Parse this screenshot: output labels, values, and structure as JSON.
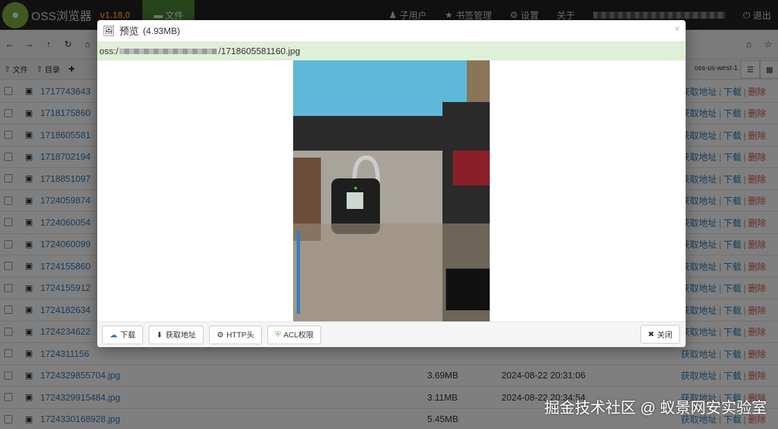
{
  "app": {
    "name": "OSS浏览器",
    "version": "v1.18.0",
    "files_tab": "文件"
  },
  "nav": {
    "subusers": "子用户",
    "bookmarks": "书签管理",
    "settings": "设置",
    "about": "关于",
    "logout": "退出"
  },
  "toolbar": {
    "upload_file": "文件",
    "upload_dir": "目录",
    "region": "oss-us-west-1"
  },
  "files": [
    {
      "name": "1717743643",
      "size": "",
      "date": ""
    },
    {
      "name": "1718175860",
      "size": "",
      "date": ""
    },
    {
      "name": "1718605581",
      "size": "",
      "date": ""
    },
    {
      "name": "1718702194",
      "size": "",
      "date": ""
    },
    {
      "name": "1718851097",
      "size": "",
      "date": ""
    },
    {
      "name": "1724059874",
      "size": "",
      "date": ""
    },
    {
      "name": "1724060054",
      "size": "",
      "date": ""
    },
    {
      "name": "1724060099",
      "size": "",
      "date": ""
    },
    {
      "name": "1724155860",
      "size": "",
      "date": ""
    },
    {
      "name": "1724155912",
      "size": "",
      "date": ""
    },
    {
      "name": "1724182634",
      "size": "",
      "date": ""
    },
    {
      "name": "1724234622",
      "size": "",
      "date": ""
    },
    {
      "name": "1724311156",
      "size": "",
      "date": ""
    },
    {
      "name": "1724329855704.jpg",
      "size": "3.69MB",
      "date": "2024-08-22 20:31:06"
    },
    {
      "name": "1724329915484.jpg",
      "size": "3.11MB",
      "date": "2024-08-22 20:34:54"
    },
    {
      "name": "1724330168928.jpg",
      "size": "5.45MB",
      "date": ""
    }
  ],
  "row_actions": {
    "get_url": "获取地址",
    "download": "下载",
    "delete": "删除"
  },
  "modal": {
    "title": "预览",
    "size": "(4.93MB)",
    "path_prefix": "oss:/",
    "path_suffix": "/1718605581160.jpg",
    "btn_download": "下载",
    "btn_get_url": "获取地址",
    "btn_http": "HTTP头",
    "btn_acl": "ACL权限",
    "btn_close": "关闭"
  },
  "watermark": "掘金技术社区 @ 蚁景网安实验室"
}
